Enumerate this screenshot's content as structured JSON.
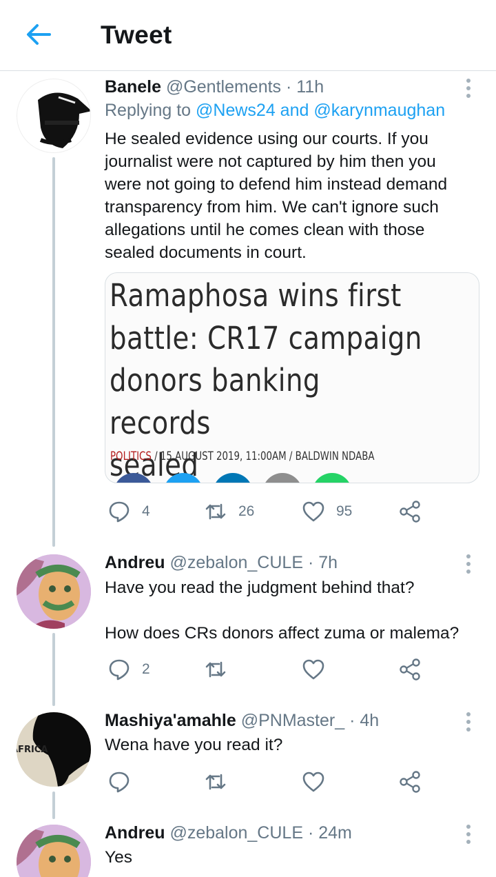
{
  "header": {
    "title": "Tweet",
    "back_icon": "arrow-left-icon"
  },
  "colors": {
    "accent": "#1da1f2",
    "muted": "#657786",
    "divider": "#d9dfe3",
    "thread_line": "#c4cfd6"
  },
  "tweets": [
    {
      "name": "Banele",
      "meta": "@Gentlements · 11h",
      "replying_prefix": "Replying to ",
      "replying_to": "@News24 and @karynmaughan",
      "text": "He sealed evidence using our courts. If you\njournalist were not captured by him then you\nwere not going to defend him instead demand\ntransparency from him. We can't ignore such\nallegations until he comes clean with those\nsealed documents in court.",
      "media": {
        "headline": "Ramaphosa wins first\nbattle: CR17 campaign\ndonors banking records\nsealed",
        "category": "POLITICS",
        "byline": " / 15 AUGUST 2019, 11:00AM / BALDWIN NDABA"
      },
      "actions": {
        "replies": "4",
        "retweets": "26",
        "likes": "95"
      }
    },
    {
      "name": "Andreu",
      "meta": "@zebalon_CULE · 7h",
      "text": "Have you read the judgment behind that?\n\nHow does CRs donors affect zuma or malema?",
      "actions": {
        "replies": "2",
        "retweets": "",
        "likes": ""
      }
    },
    {
      "name": "Mashiya'amahle",
      "meta": "@PNMaster_ · 4h",
      "avatar_text": "AFRICA",
      "text": "Wena have you read it?",
      "actions": {
        "replies": "",
        "retweets": "",
        "likes": ""
      }
    },
    {
      "name": "Andreu",
      "meta": "@zebalon_CULE · 24m",
      "text": "Yes"
    }
  ]
}
